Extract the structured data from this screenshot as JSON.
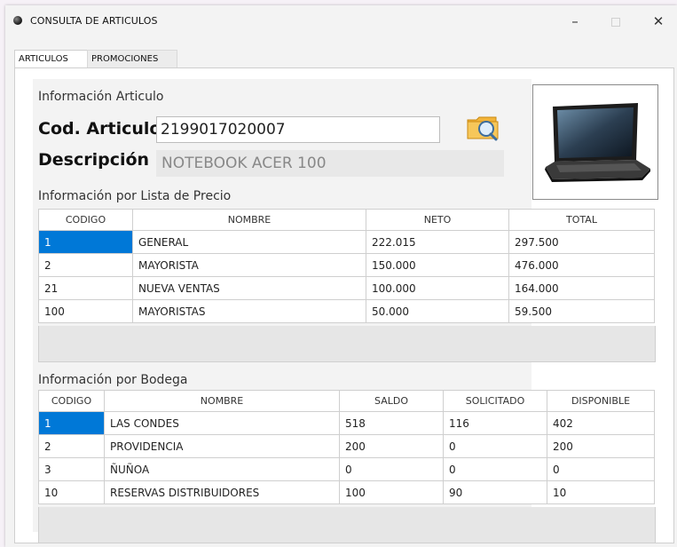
{
  "window": {
    "title": "CONSULTA DE ARTICULOS",
    "minimize": "–",
    "close": "✕"
  },
  "tabs": [
    {
      "label": "ARTICULOS",
      "active": true
    },
    {
      "label": "PROMOCIONES",
      "active": false
    }
  ],
  "article": {
    "section_title": "Información Articulo",
    "code_label": "Cod. Articulo",
    "code_value": "2199017020007",
    "desc_label": "Descripción",
    "desc_value": "NOTEBOOK ACER 100"
  },
  "price_list": {
    "title": "Información por Lista de Precio",
    "columns": [
      "CODIGO",
      "NOMBRE",
      "NETO",
      "TOTAL"
    ],
    "rows": [
      [
        "1",
        "GENERAL",
        "222.015",
        "297.500"
      ],
      [
        "2",
        "MAYORISTA",
        "150.000",
        "476.000"
      ],
      [
        "21",
        "NUEVA VENTAS",
        "100.000",
        "164.000"
      ],
      [
        "100",
        "MAYORISTAS",
        "50.000",
        "59.500"
      ]
    ]
  },
  "warehouse": {
    "title": "Información por Bodega",
    "columns": [
      "CODIGO",
      "NOMBRE",
      "SALDO",
      "SOLICITADO",
      "DISPONIBLE"
    ],
    "rows": [
      [
        "1",
        "LAS CONDES",
        "518",
        "116",
        "402"
      ],
      [
        "2",
        "PROVIDENCIA",
        "200",
        "0",
        "200"
      ],
      [
        "3",
        "ÑUÑOA",
        "0",
        "0",
        "0"
      ],
      [
        "10",
        "RESERVAS DISTRIBUIDORES",
        "100",
        "90",
        "10"
      ]
    ]
  },
  "colors": {
    "selection": "#0078d7",
    "grid_border": "#cfcfcf"
  },
  "icons": {
    "app": "app-icon",
    "search": "magnifier-folder-icon",
    "product": "laptop-image"
  }
}
